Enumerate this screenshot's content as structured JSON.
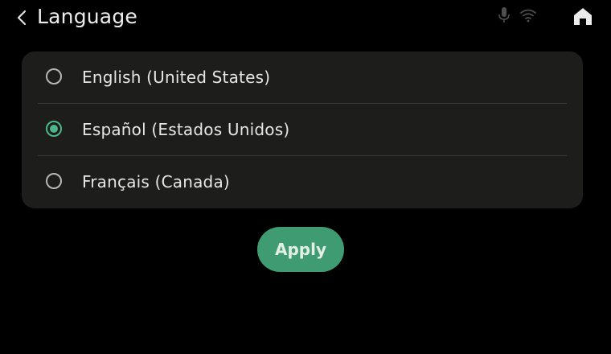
{
  "header": {
    "back_icon": "chevron-left-icon",
    "title": "Language",
    "status_icons": [
      "microphone-icon",
      "wifi-icon"
    ],
    "home_icon": "home-icon"
  },
  "languages": {
    "options": [
      {
        "label": "English (United States)",
        "selected": false
      },
      {
        "label": "Español (Estados Unidos)",
        "selected": true
      },
      {
        "label": "Français (Canada)",
        "selected": false
      }
    ]
  },
  "actions": {
    "apply_label": "Apply"
  },
  "colors": {
    "background": "#000000",
    "card": "#1d1d1b",
    "accent": "#4cb88a",
    "apply_button": "#3f9b71",
    "text": "#e6e6e6"
  }
}
